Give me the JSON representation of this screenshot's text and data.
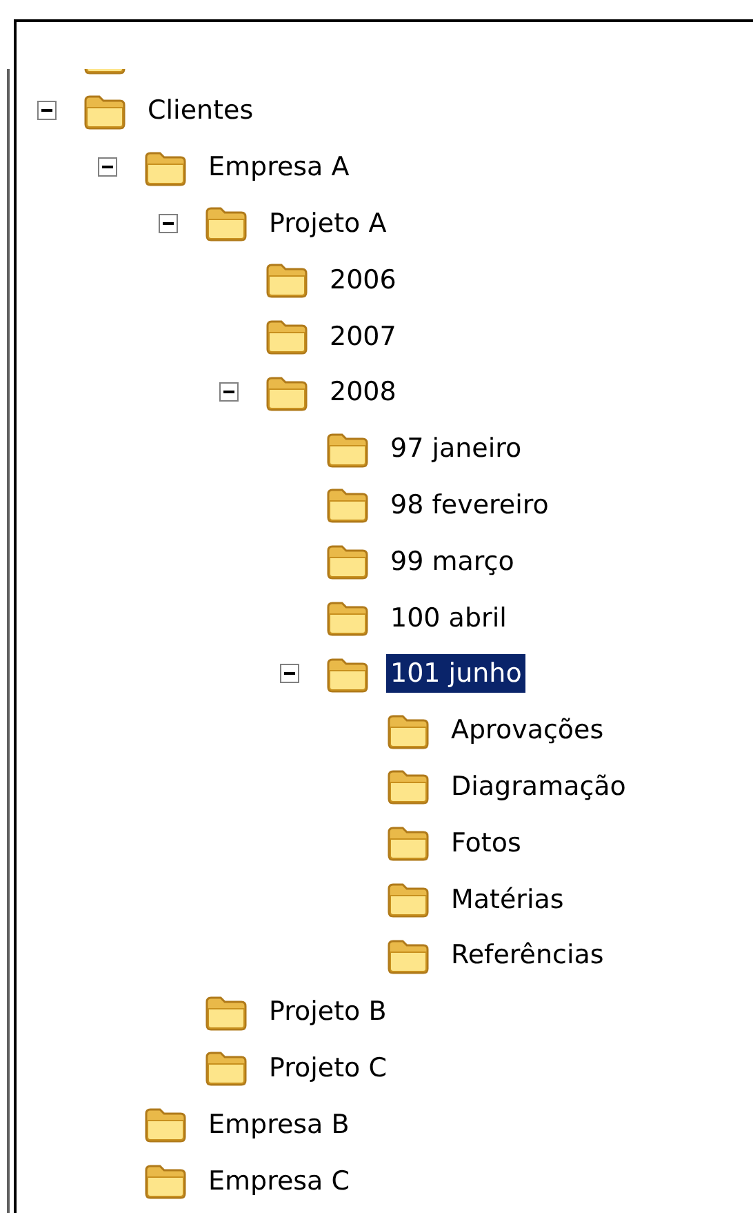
{
  "tree": [
    {
      "label": "Clientes",
      "expanded": true,
      "selected": false,
      "children": [
        {
          "label": "Empresa A",
          "expanded": true,
          "selected": false,
          "children": [
            {
              "label": "Projeto A",
              "expanded": true,
              "selected": false,
              "children": [
                {
                  "label": "2006",
                  "selected": false
                },
                {
                  "label": "2007",
                  "selected": false
                },
                {
                  "label": "2008",
                  "expanded": true,
                  "selected": false,
                  "children": [
                    {
                      "label": "97 janeiro",
                      "selected": false
                    },
                    {
                      "label": "98 fevereiro",
                      "selected": false
                    },
                    {
                      "label": "99 março",
                      "selected": false
                    },
                    {
                      "label": "100 abril",
                      "selected": false
                    },
                    {
                      "label": "101 junho",
                      "expanded": true,
                      "selected": true,
                      "children": [
                        {
                          "label": "Aprovações",
                          "selected": false
                        },
                        {
                          "label": "Diagramação",
                          "selected": false
                        },
                        {
                          "label": "Fotos",
                          "selected": false
                        },
                        {
                          "label": "Matérias",
                          "selected": false
                        },
                        {
                          "label": "Referências",
                          "selected": false
                        }
                      ]
                    }
                  ]
                }
              ]
            },
            {
              "label": "Projeto B",
              "selected": false
            },
            {
              "label": "Projeto C",
              "selected": false
            }
          ]
        },
        {
          "label": "Empresa B",
          "selected": false
        },
        {
          "label": "Empresa C",
          "selected": false
        }
      ]
    }
  ]
}
